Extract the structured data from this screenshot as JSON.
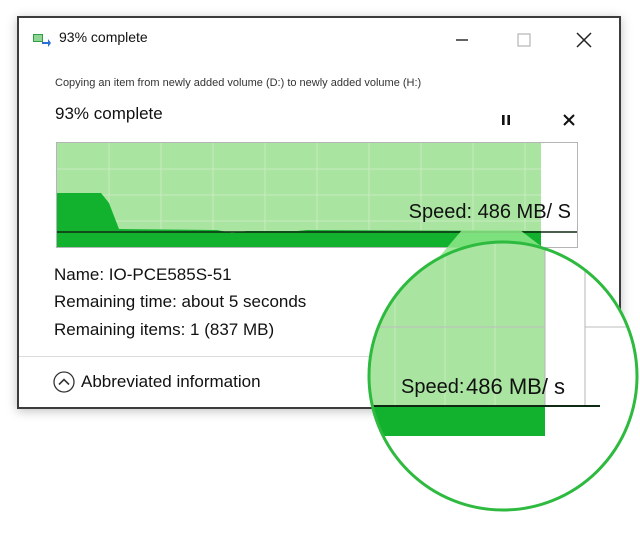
{
  "window": {
    "title": "93% complete",
    "icon": "copy-transfer-icon",
    "controls": {
      "minimize": "minimize-icon",
      "maximize": "maximize-icon",
      "close": "close-icon"
    }
  },
  "transfer": {
    "description": "Copying an item from newly added volume (D:) to newly added volume (H:)",
    "percent_text": "93% complete",
    "progress": 0.93,
    "pause_icon": "pause-icon",
    "cancel_icon": "close-icon",
    "speed_text": "Speed: 486 MB/ S"
  },
  "details": {
    "name": "Name: IO-PCE585S-51",
    "remaining_time": "Remaining time: about 5 seconds",
    "remaining_items": "Remaining items: 1 (837 MB)"
  },
  "footer": {
    "toggle_label": "Abbreviated information",
    "toggle_icon": "chevron-up-circle-icon"
  },
  "zoom": {
    "speed_label": "Speed:",
    "speed_value": "486 MB/ s"
  },
  "colors": {
    "fill_light": "#a9e5a0",
    "fill_dark": "#12b22f",
    "grid": "#c7ebc0",
    "zoom_ring": "#2dba3f",
    "zoom_highlight": "#8fe88a"
  }
}
